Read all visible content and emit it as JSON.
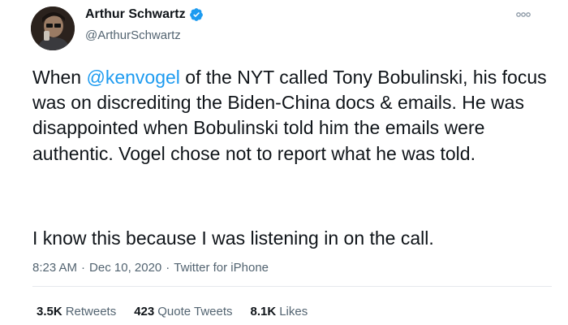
{
  "author": {
    "display_name": "Arthur Schwartz",
    "handle": "@ArthurSchwartz",
    "verified_icon": "verified-badge-icon"
  },
  "tweet": {
    "text_before_mention": "When ",
    "mention": "@kenvogel",
    "text_after_mention": " of the NYT called Tony Bobulinski, his focus was on discrediting the Biden-China docs & emails. He was disappointed when Bobulinski told him the emails were authentic. Vogel chose not to report what he was told.",
    "paragraph_2": "I know this because I was listening in on the call."
  },
  "meta": {
    "time": "8:23 AM",
    "separator": "·",
    "date": "Dec 10, 2020",
    "source": "Twitter for iPhone"
  },
  "stats": {
    "retweets_count": "3.5K",
    "retweets_label": "Retweets",
    "quotes_count": "423",
    "quotes_label": "Quote Tweets",
    "likes_count": "8.1K",
    "likes_label": "Likes"
  },
  "colors": {
    "accent": "#1d9bf0",
    "text": "#0f1419",
    "secondary": "#536471"
  }
}
